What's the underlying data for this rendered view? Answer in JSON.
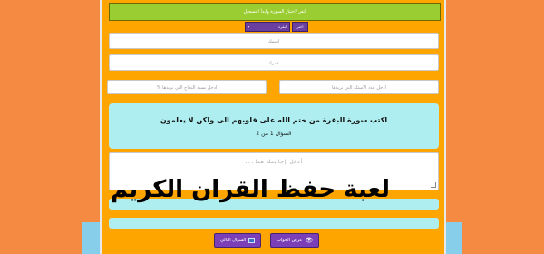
{
  "colors": {
    "background": "#f58a42",
    "panel": "#ffa500",
    "notice": "#9acd32",
    "question_box": "#aeeef0",
    "button": "#7b3fb8",
    "bottom_band": "#87ceeb"
  },
  "notice": {
    "text": "انقر لاختيار السورة وابدأ التسجيل"
  },
  "surah_selector": {
    "selected": "البقرة",
    "button_label": "اختر"
  },
  "form": {
    "name_placeholder": "اسمك",
    "age_placeholder": "عمرك",
    "questions_count_placeholder": "ادخل عدد الاسئلة التي تريدها",
    "success_percent_placeholder": "ادخل نسبة النجاح التي تريدها %"
  },
  "question": {
    "text": "اكتب سورة البقرة من ختم الله على قلوبهم الى ولكن لا يعلمون",
    "counter": "السؤال 1 من 2"
  },
  "answer": {
    "placeholder": "أدخل إجابتك هنا..."
  },
  "buttons": {
    "show_answer": "عرض الجواب",
    "next_question": "السؤال التالي"
  },
  "game_title": "لعبة حفظ القران الكريم"
}
